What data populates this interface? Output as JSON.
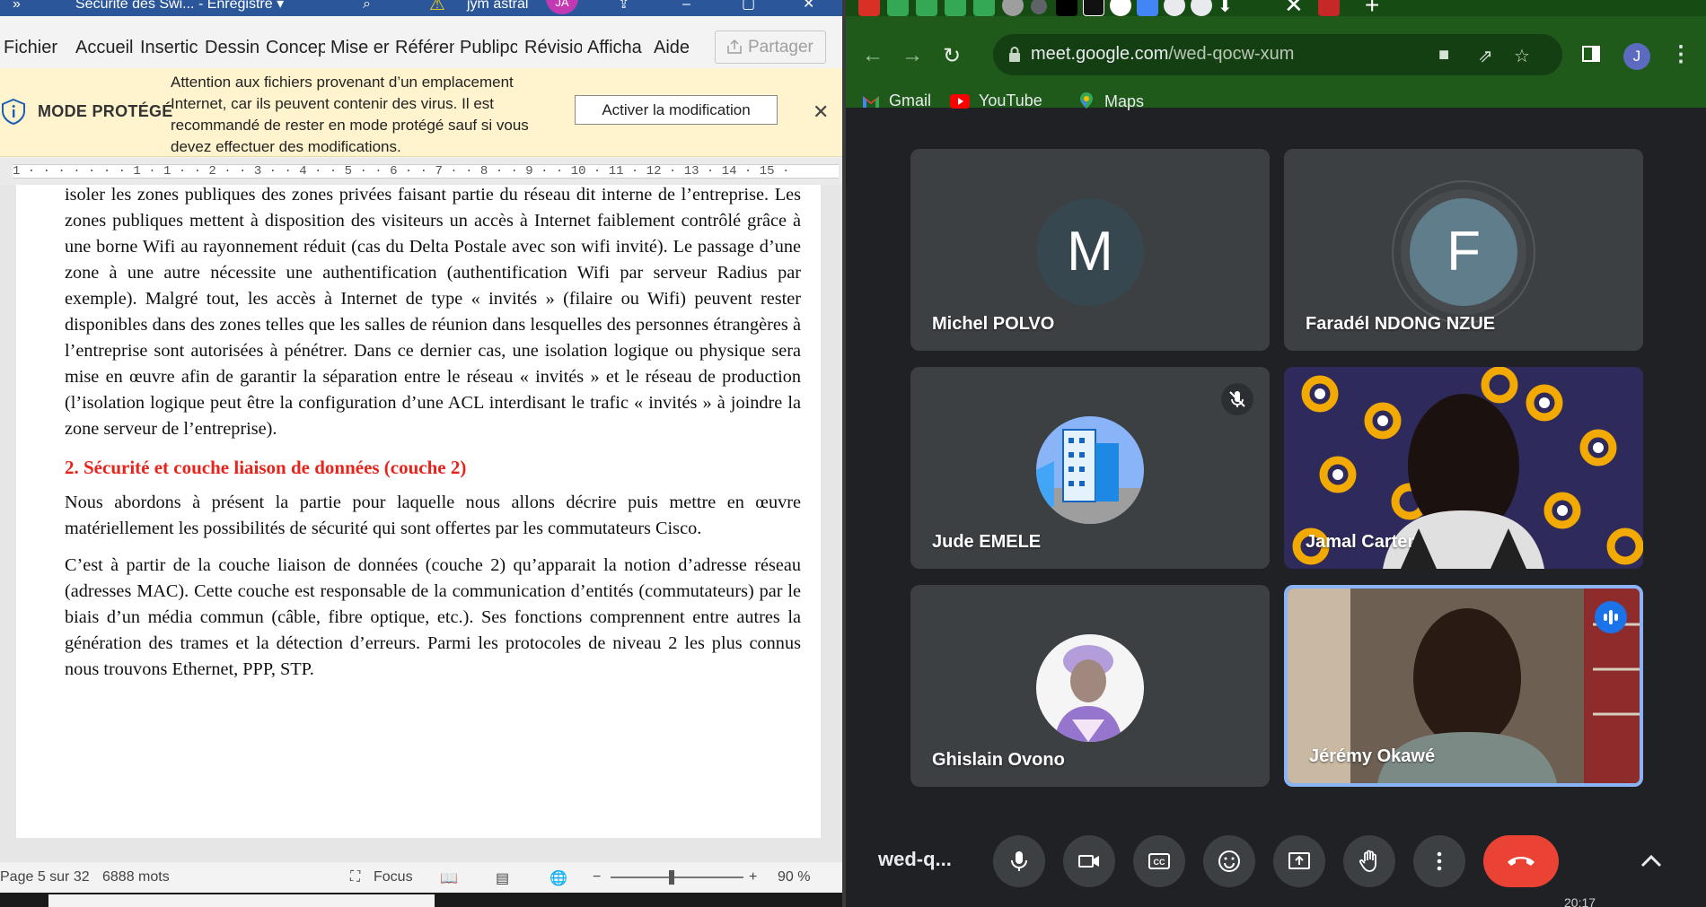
{
  "word": {
    "title": "Sécurité des Swi...  -  Enregistré ▾",
    "user_name": "jym astral",
    "user_initials": "JA",
    "menu": [
      "Fichier",
      "Accueil",
      "Insertic",
      "Dessin",
      "Concep",
      "Mise er",
      "Référen",
      "Publipc",
      "Révisio",
      "Afficha",
      "Aide"
    ],
    "share_label": "Partager",
    "protected": {
      "title": "MODE PROTÉGÉ",
      "message": "Attention aux fichiers provenant d’un emplacement Internet, car ils peuvent contenir des virus. Il est recommandé de rester en mode protégé sauf si vous devez effectuer des modifications.",
      "button": "Activer la modification"
    },
    "ruler": "1 · · · · · · · 1 · 1 · · 2 · · 3 · · 4 · · 5 · · 6 · · 7 · · 8 · · 9 · · 10 · 11 · 12 · 13 · 14 · 15 ·",
    "doc": {
      "para1": "isoler les zones publiques des zones privées faisant partie du réseau dit interne de l’entreprise. Les zones publiques mettent à disposition des visiteurs un accès à Internet faiblement contrôlé grâce à une borne Wifi au rayonnement réduit (cas du Delta Postale avec son wifi invité). Le passage d’une zone à une autre nécessite une authentification (authentification Wifi par serveur Radius par exemple). Malgré tout, les accès à Internet de type « invités » (filaire ou Wifi) peuvent rester disponibles dans des zones telles que les salles de réunion dans lesquelles des personnes étrangères à l’entreprise sont autorisées à pénétrer.  Dans ce dernier cas, une isolation logique ou physique  sera mise en œuvre afin de garantir la séparation entre le réseau « invités » et le réseau de production (l’isolation logique peut être la configuration d’une ACL interdisant le trafic « invités » à joindre la zone serveur de l’entreprise).",
      "heading": "2. Sécurité et couche liaison de données (couche 2)",
      "para2": "Nous abordons à présent la partie pour laquelle nous allons décrire puis mettre en œuvre matériellement les possibilités de sécurité qui sont offertes par les commutateurs Cisco.",
      "para3": "C’est à partir de la couche liaison de données (couche 2) qu’apparait la notion d’adresse réseau (adresses MAC). Cette couche est responsable de la communication d’entités (commutateurs) par le biais d’un média commun (câble, fibre optique, etc.). Ses fonctions comprennent entre autres la génération des trames et la détection d’erreurs.  Parmi les protocoles de niveau 2 les plus connus nous trouvons Ethernet, PPP, STP."
    },
    "status": {
      "page": "Page 5 sur 32",
      "words": "6888 mots",
      "focus": "Focus",
      "zoom": "90 %"
    }
  },
  "chrome": {
    "url_host": "meet.google.com",
    "url_path": "/wed-qocw-xum",
    "profile_initial": "J",
    "bookmarks": [
      "Gmail",
      "YouTube",
      "Maps"
    ]
  },
  "meet": {
    "participants": [
      {
        "name": "Michel POLVO",
        "initial": "M",
        "color": "#37474f"
      },
      {
        "name": "Faradél NDONG NZUE",
        "initial": "F",
        "color": "#607d8b"
      },
      {
        "name": "Jude EMELE"
      },
      {
        "name": "Jamal Carter"
      },
      {
        "name": "Ghislain Ovono"
      },
      {
        "name": "Jérémy Okawé"
      }
    ],
    "meeting_code": "wed-q...",
    "accent": "#8ab4f8",
    "end_call_color": "#ea4335"
  },
  "taskbar": {
    "clock": "20:17"
  }
}
